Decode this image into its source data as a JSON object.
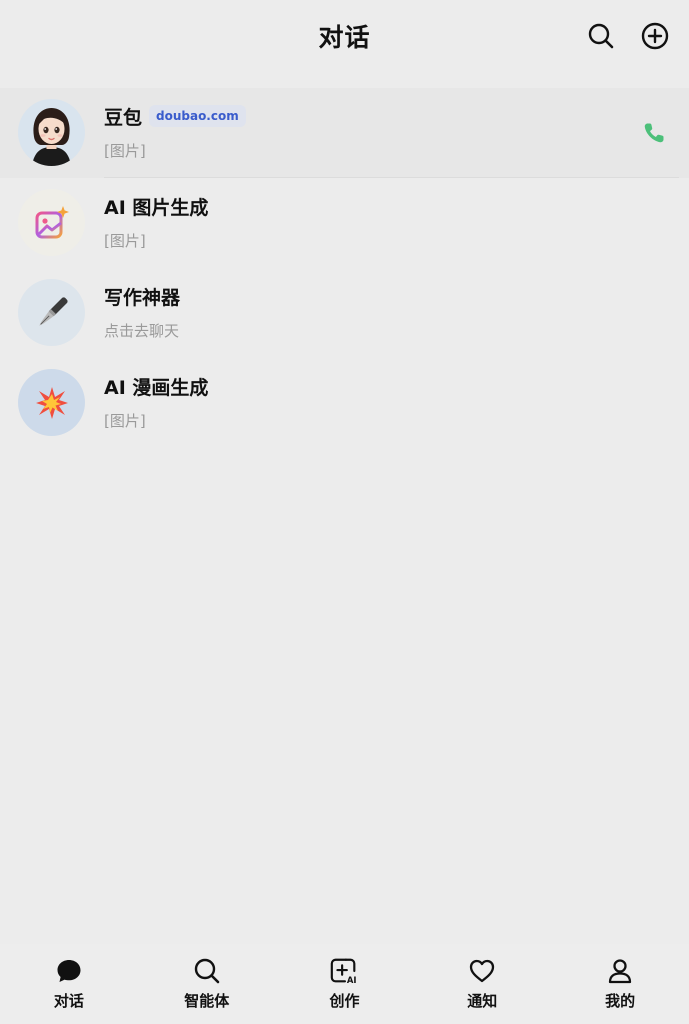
{
  "header": {
    "title": "对话",
    "icons": [
      "search-icon",
      "add-circle-icon"
    ]
  },
  "chats": [
    {
      "name": "豆包",
      "badge": "doubao.com",
      "preview": "[图片]",
      "avatar": "girl-avatar",
      "action_icon": "phone-icon",
      "active": true
    },
    {
      "name": "AI 图片生成",
      "preview": "[图片]",
      "avatar": "image-sparkle-icon"
    },
    {
      "name": "写作神器",
      "preview": "点击去聊天",
      "avatar": "fountain-pen-icon"
    },
    {
      "name": "AI 漫画生成",
      "preview": "[图片]",
      "avatar": "explosion-icon"
    }
  ],
  "nav": [
    {
      "label": "对话",
      "icon": "chat-bubble-icon",
      "active": true
    },
    {
      "label": "智能体",
      "icon": "search-icon"
    },
    {
      "label": "创作",
      "icon": "create-ai-icon"
    },
    {
      "label": "通知",
      "icon": "heart-icon"
    },
    {
      "label": "我的",
      "icon": "user-icon"
    }
  ],
  "colors": {
    "background": "#ececec",
    "badge_text": "#3a5ccc",
    "badge_bg": "#dfe3ee",
    "phone": "#4cc07a",
    "preview_text": "#9a9a9a"
  }
}
